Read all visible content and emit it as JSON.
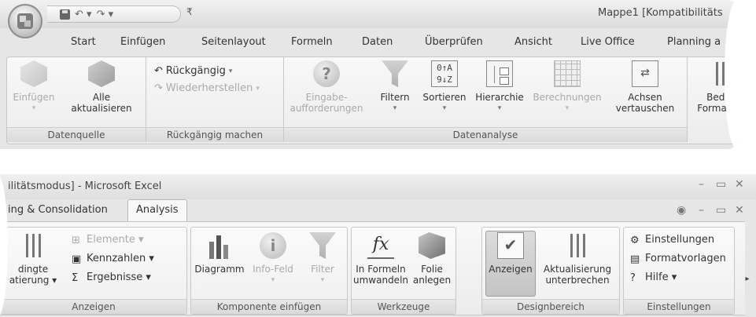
{
  "top": {
    "window_title": "Mappe1  [Kompatibilitäts",
    "tabs": [
      "Start",
      "Einfügen",
      "Seitenlayout",
      "Formeln",
      "Daten",
      "Überprüfen",
      "Ansicht",
      "Live Office",
      "Planning a"
    ],
    "datenquelle": {
      "label": "Datenquelle",
      "einfuegen": {
        "line1": "Einfügen",
        "caret": "▾"
      },
      "alle": {
        "line1": "Alle",
        "line2": "aktualisieren"
      }
    },
    "rueckgaengig": {
      "label": "Rückgängig machen",
      "undo": "Rückgängig",
      "redo": "Wiederherstellen",
      "caret": "▾"
    },
    "datenanalyse": {
      "label": "Datenanalyse",
      "eingabe": {
        "line1": "Eingabe-",
        "line2": "aufforderungen"
      },
      "filtern": "Filtern",
      "sortieren": "Sortieren",
      "hierarchie": "Hierarchie",
      "berechnungen": "Berechnungen",
      "achsen": {
        "line1": "Achsen",
        "line2": "vertauschen"
      },
      "caret": "▾"
    },
    "bedingte": {
      "line1": "Beding",
      "line2": "Formatieru"
    }
  },
  "bottom": {
    "window_title": "ilitätsmodus] - Microsoft Excel",
    "tab_left": "ing & Consolidation",
    "tab_active": "Analysis",
    "anzeigen": {
      "label": "Anzeigen",
      "bedingte": {
        "line1": "dingte",
        "line2": "atierung ▾"
      },
      "elemente": "Elemente ▾",
      "kennzahlen": "Kennzahlen ▾",
      "ergebnisse": "Ergebnisse ▾"
    },
    "komponente": {
      "label": "Komponente einfügen",
      "diagramm": "Diagramm",
      "infofeld": "Info-Feld",
      "filter": "Filter",
      "caret": "▾"
    },
    "werkzeuge": {
      "label": "Werkzeuge",
      "formeln": {
        "line1": "In Formeln",
        "line2": "umwandeln"
      },
      "folie": {
        "line1": "Folie",
        "line2": "anlegen"
      }
    },
    "designbereich": {
      "label": "Designbereich",
      "anzeigen": "Anzeigen",
      "aktualisierung": {
        "line1": "Aktualisierung",
        "line2": "unterbrechen"
      }
    },
    "einstellungen": {
      "label": "Einstellungen",
      "einstellungen": "Einstellungen",
      "formatvorlagen": "Formatvorlagen",
      "hilfe": "Hilfe ▾"
    }
  }
}
